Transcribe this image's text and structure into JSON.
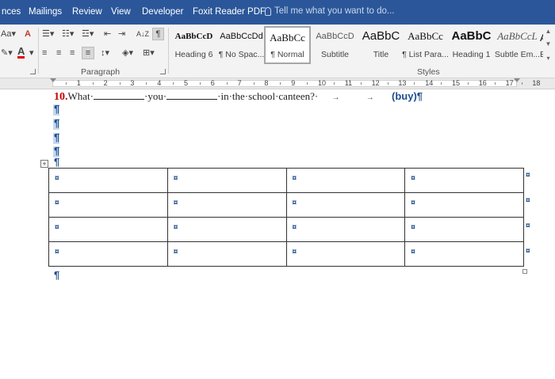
{
  "tabs": [
    "nces",
    "Mailings",
    "Review",
    "View",
    "Developer",
    "Foxit Reader PDF"
  ],
  "tell_me": "Tell me what you want to do...",
  "ribbon": {
    "paragraph_label": "Paragraph",
    "styles_label": "Styles",
    "font_case_button": "Aa",
    "sort_button": "A↓Z",
    "show_marks_button": "¶"
  },
  "styles": [
    {
      "preview": "AaBbCcD",
      "name": "Heading 6"
    },
    {
      "preview": "AaBbCcDd",
      "name": "¶ No Spac..."
    },
    {
      "preview": "AaBbCc",
      "name": "¶ Normal"
    },
    {
      "preview": "AaBbCcD",
      "name": "Subtitle"
    },
    {
      "preview": "AaBbC",
      "name": "Title"
    },
    {
      "preview": "AaBbCc",
      "name": "¶ List Para..."
    },
    {
      "preview": "AaBbC",
      "name": "Heading 1"
    },
    {
      "preview": "AaBbCcL",
      "name": "Subtle Em..."
    },
    {
      "preview": "A",
      "name": "En"
    }
  ],
  "selected_style": "¶ Normal",
  "ruler": {
    "numbers": [
      "1",
      "2",
      "3",
      "4",
      "5",
      "6",
      "7",
      "8",
      "9",
      "10",
      "11",
      "12",
      "13",
      "14",
      "15",
      "16",
      "17",
      "18"
    ]
  },
  "document": {
    "question_number": "10.",
    "question_part1": "What·",
    "question_part2": "·you·",
    "question_part3": "·in·the·school·canteen?·",
    "arrow": "→",
    "answer": "(buy)¶",
    "pilcrow": "¶",
    "cell_mark": "¤",
    "table_rows": 4,
    "table_cols": 4
  }
}
